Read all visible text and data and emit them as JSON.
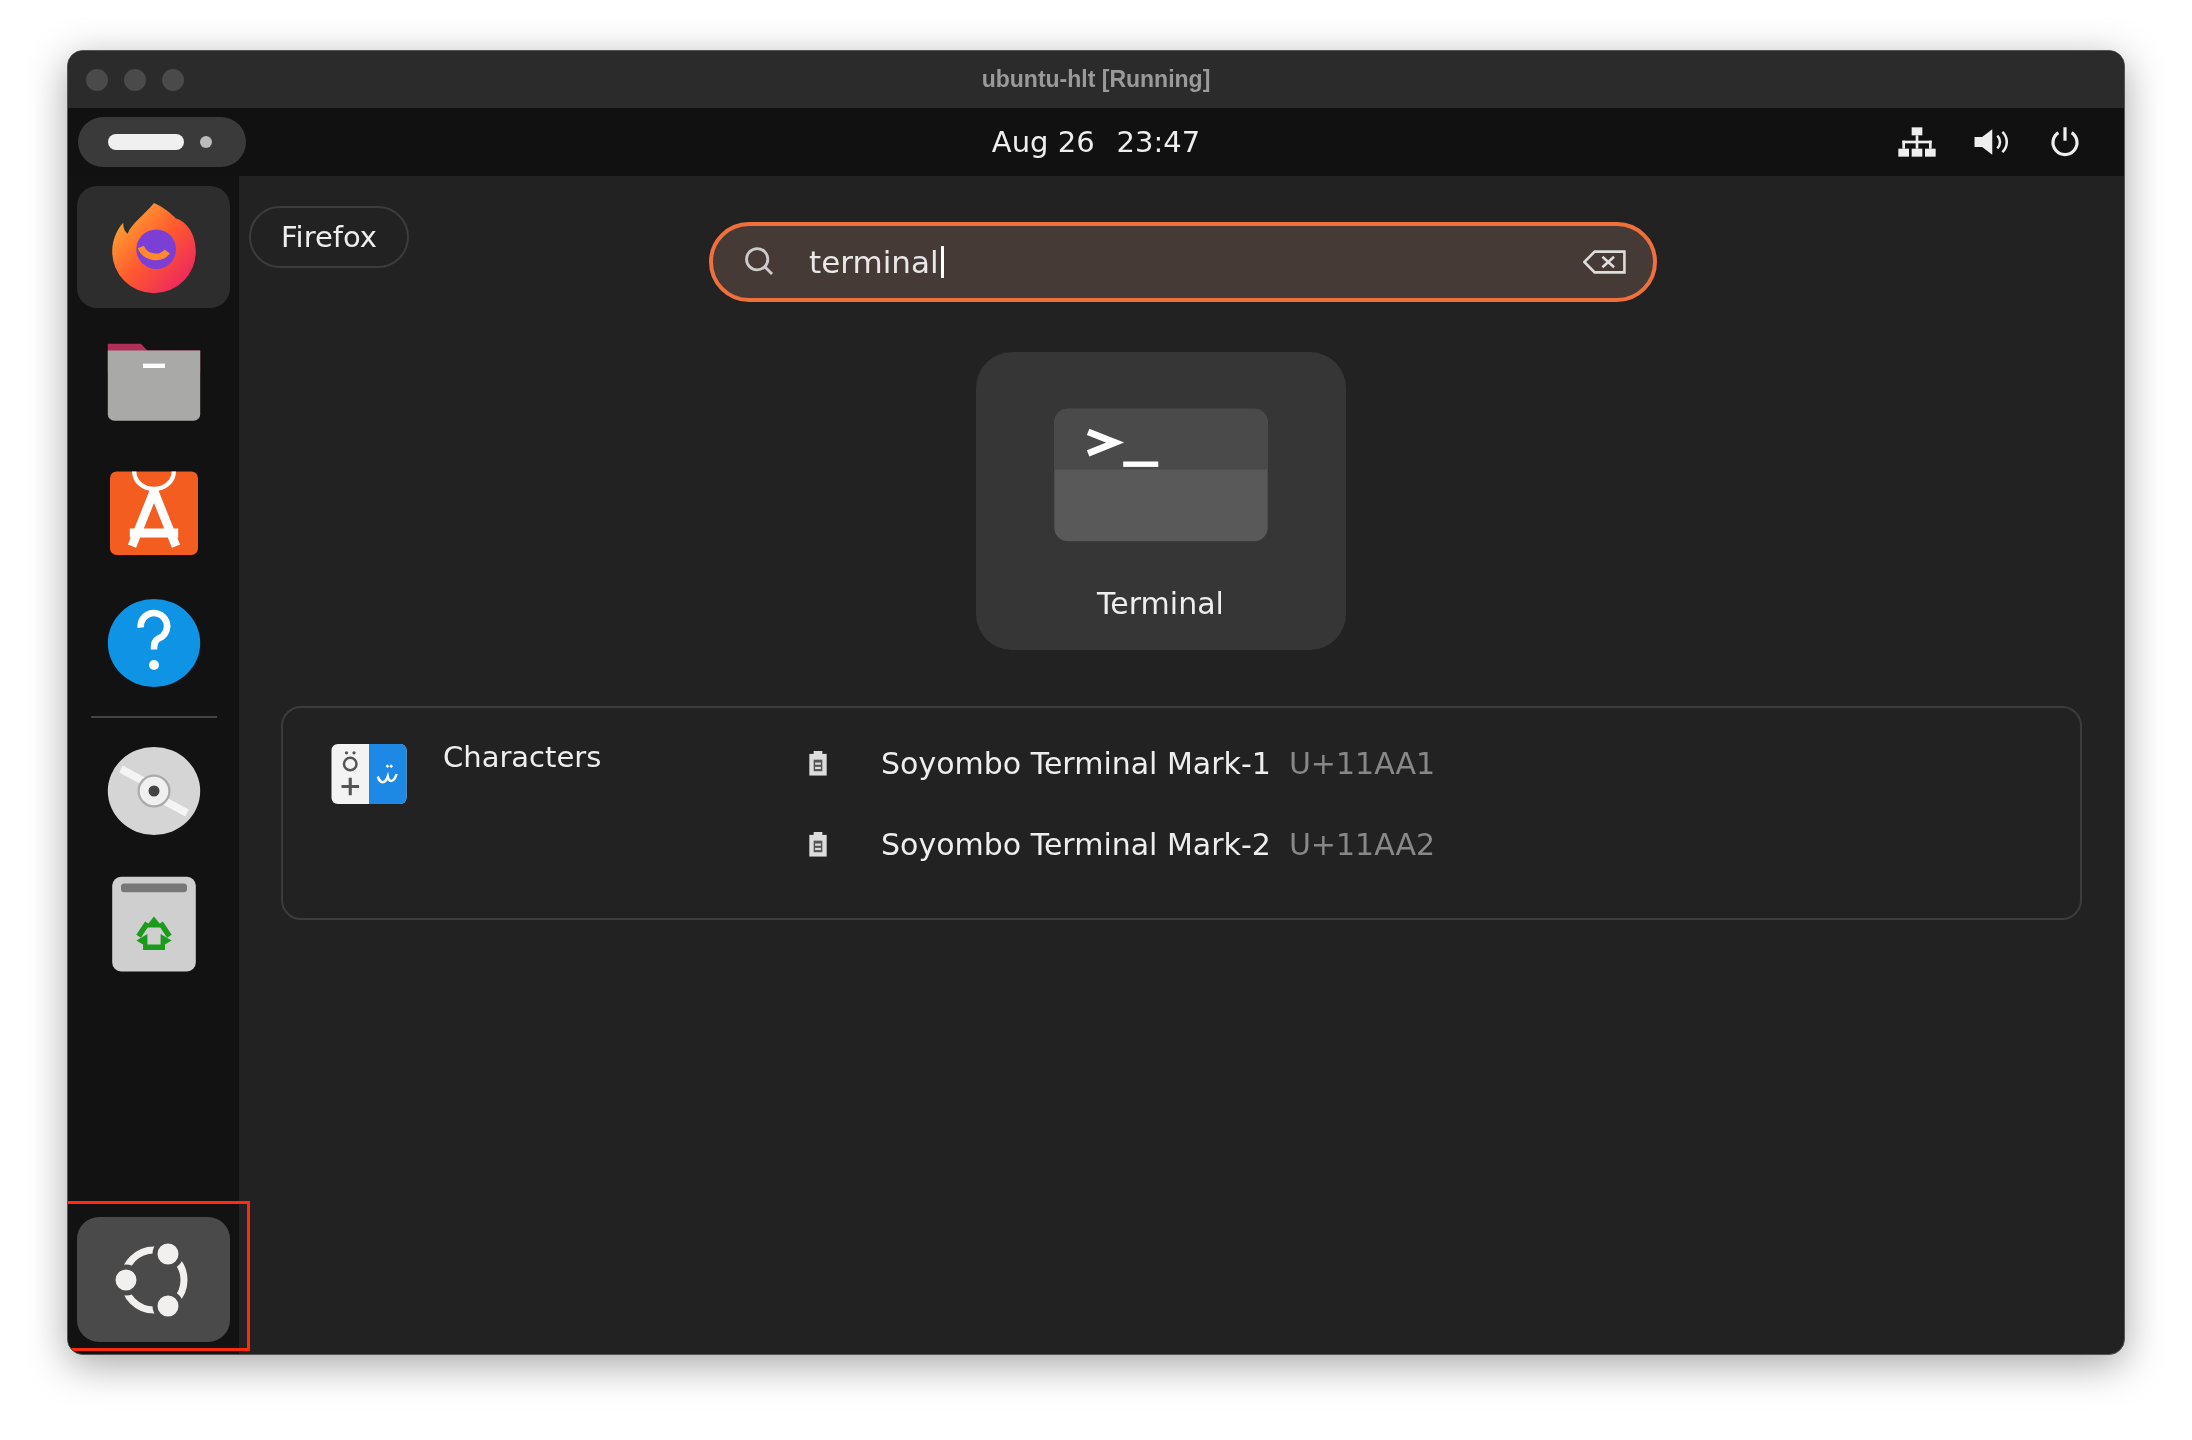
{
  "window": {
    "title": "ubuntu-hlt [Running]"
  },
  "top_bar": {
    "date": "Aug 26",
    "time": "23:47"
  },
  "dock": {
    "apps": [
      {
        "kind": "firefox",
        "selected": true
      },
      {
        "kind": "files",
        "selected": false
      },
      {
        "kind": "software",
        "selected": false
      },
      {
        "kind": "help",
        "selected": false
      }
    ],
    "mounts": [
      {
        "kind": "disc",
        "selected": false
      },
      {
        "kind": "trash",
        "selected": false
      }
    ],
    "show_apps": {
      "highlighted": true
    }
  },
  "window_label": "Firefox",
  "search": {
    "value": "terminal"
  },
  "app_results": [
    {
      "name": "Terminal",
      "kind": "terminal",
      "selected": true
    }
  ],
  "providers": [
    {
      "name": "Characters",
      "kind": "characters",
      "results": [
        {
          "name": "Soyombo Terminal Mark-1",
          "code": "U+11AA1"
        },
        {
          "name": "Soyombo Terminal Mark-2",
          "code": "U+11AA2"
        }
      ]
    }
  ]
}
